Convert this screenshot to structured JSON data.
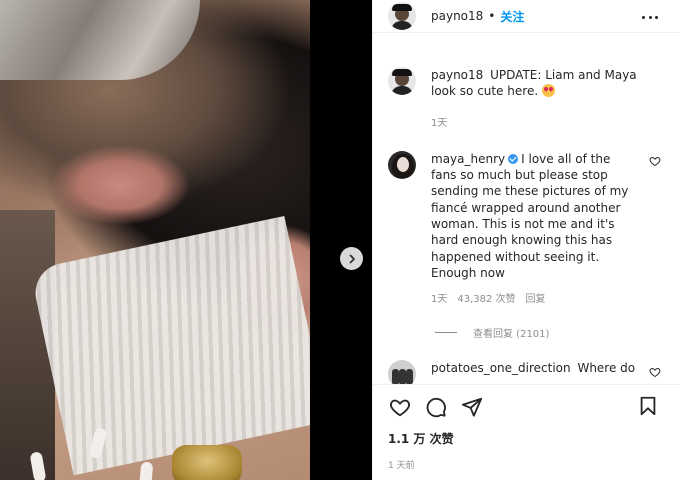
{
  "post": {
    "author": "payno18",
    "separator": "•",
    "follow_label": "关注",
    "more_icon": "more-horizontal-icon"
  },
  "comments": [
    {
      "username": "payno18",
      "verified": false,
      "text": "UPDATE: Liam and Maya look so cute here.",
      "emoji": "heart-eyes-emoji",
      "time": "1天"
    },
    {
      "username": "maya_henry",
      "verified": true,
      "text": "I love all of the fans so much but please stop sending me these pictures of my fiancé wrapped around another woman. This is not me and it's hard enough knowing this has happened without seeing it. Enough now",
      "time": "1天",
      "likes": "43,382 次赞",
      "reply_label": "回复",
      "view_replies": "查看回复 (2101)"
    },
    {
      "username": "potatoes_one_direction",
      "verified": false,
      "text": "Where do"
    }
  ],
  "actions": {
    "like_icon": "heart-icon",
    "comment_icon": "comment-icon",
    "share_icon": "paper-plane-icon",
    "save_icon": "bookmark-icon",
    "likes_count": "1.1 万 次赞",
    "posted_time": "1 天前"
  },
  "media": {
    "next_icon": "chevron-right-icon"
  }
}
